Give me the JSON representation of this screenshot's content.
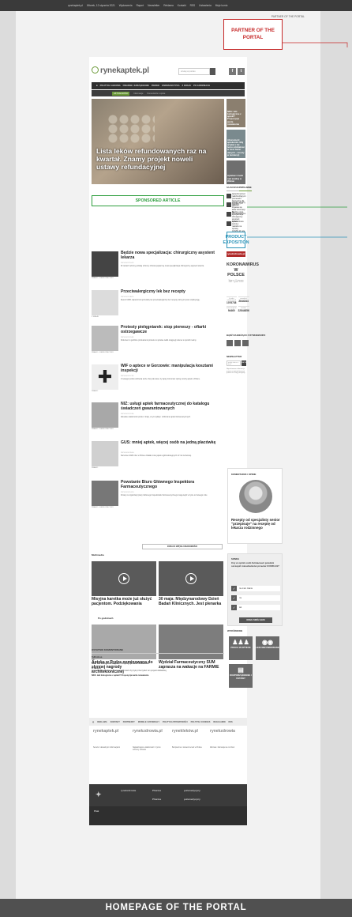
{
  "topbar": {
    "items": [
      "rynekaptek.pl",
      "Wtorek, 12 stycznia 2021",
      "Wydarzenia",
      "Raport",
      "Newsletter",
      "Reklama",
      "Kontakt",
      "RSS",
      "Ustawienia",
      "Moje konto"
    ]
  },
  "annotations": {
    "partner_label": "PARTNER OF THE PORTAL",
    "partner_box": "PARTNER OF THE PORTAL",
    "sponsored": "SPONSORED ARTICLE",
    "product": "PRODUCT EXPOSITION",
    "homepage_caption": "HOMEPAGE OF THE PORTAL"
  },
  "header": {
    "logo": "rynekaptek.pl",
    "search_placeholder": "szukaj w portalu",
    "social": [
      "f",
      "t"
    ]
  },
  "nav": {
    "main": [
      "POLITYKA LEKOWA",
      "FINANSE I ZARZĄDZANIE",
      "PRAWO",
      "FARMACEUTYKA",
      "Z KRAJU",
      "PO GODZINACH"
    ],
    "sub": [
      "AKTUALNOŚCI",
      "Informacje",
      "Komentarze i opinie"
    ]
  },
  "hero": {
    "title": "Lista leków refundowanych raz na kwartał. Znamy projekt noweli ustawy refundacyjnej"
  },
  "side_thumbs": [
    "NRA: leki biologiczne z apteki? Propozycja warta rozważenia",
    "Abonament aptekarski. Mój artykuł z lat temu oddziałowi w sieci bazie danych – koszty w tendencji",
    "Aptekarz trudzi nad analizą w Wuhan"
  ],
  "tabs": [
    "NAJNOWSZE",
    "POPULARNE"
  ],
  "popular": [
    "Apteczki przed nadchodzącymi procesami. Narzędzia dla aptekarzy w aptece",
    "Kolejny skrajny ruch! 10. Pojawia się kilka informacji po przekształceniu",
    "Będzie nowa specjalizacja: chirurgiczny asystent lekarza",
    "Apteki: Nowe terminy nalotów na sprawy COVID-19, ale nie ma szansy"
  ],
  "exposition_widget": {
    "header": "rynekzdrowia.pl",
    "title": "KORONAWIRUS W POLSCE",
    "date": "Stan na 11 stycznia 2021 r. godz. 10:30",
    "stats": [
      {
        "value": "1076738",
        "label": "Liczba zakażonych"
      },
      {
        "value": "2844344",
        "label": "zmarłych"
      },
      {
        "value": "94460",
        "label": "zaszczepieni"
      },
      {
        "value": "22844856",
        "label": "testów"
      }
    ]
  },
  "follow_title": "BĄDŹ NA BIEŻĄCO Z RYNKIEM.INFO",
  "newsletter": {
    "title": "NEWSLETTER",
    "placeholder": "podaj adres e-mail",
    "button": "ZAPISZ",
    "desc": "Najciekawsze informacje prosto ze świata farmacji prosto na Twoją skrzynkę"
  },
  "articles": [
    {
      "title": "Będzie nowa specjalizacja: chirurgiczny asystent lekarza",
      "category": "PRAWO I ORZECZNICTWO",
      "date": "2021-01-12 10:25",
      "excerpt": "W ramach reformy polskiej ochrony zdrowia pojawi się nowa specjalizacja chirurgiczny asystent lekarza."
    },
    {
      "title": "Przeciwalergiczny lek bez recepty",
      "category": "Z KRAJU",
      "date": "2021-01-12 08:15",
      "excerpt": "Resort URPL dopuścił do sprzedaży lek przeciwalergiczny bez recepty, który przynosi szybką ulgę."
    },
    {
      "title": "Protesty pielęgniarek: stop pierwszy - ofiarki ostrzegawcze",
      "category": "PRAWO I ORZECZNICTWO",
      "date": "2021-01-11 19:05",
      "excerpt": "Dokument o godzinie przekazaniu protestu w sprawie walki osiągnęły sukces w sposób realny."
    },
    {
      "title": "WIF o aptece w Gorzowie: manipulacja kosztami inspekcji",
      "category": "PRAWO",
      "date": "2021-01-11 17:30",
      "excerpt": "Z nowego punktu widzenia tenże chcę tak wiele, by lepiej zrozumieć opinię; koszty aptek w Polsce."
    },
    {
      "title": "NIZ: usługi aptek farmaceutycznej do katalogu świadczeń gwarantowanych",
      "category": "PRAWO I ORZECZNICTWO",
      "date": "2021-01-11 12:40",
      "excerpt": "Aktualne wiadomości prosto z kraju, w tym opłaty i rozliczanie aptek farmaceutycznych."
    },
    {
      "title": "GUS: mniej aptek, więcej osób na jedną placówkę",
      "category": "PRAWO",
      "date": "2021-01-10 20:00",
      "excerpt": "Na koniec 2020 roku w Polsce działało mniej aptek ogólnodostępnych niż rok wcześniej."
    },
    {
      "title": "Powstanie Biuro Głównego Inspektora Farmaceutycznego",
      "category": "PRAWO I ORZECZNICTWO",
      "date": "2021-01-10 14:10",
      "excerpt": "Zmiany w organizacji pracy Głównego Inspektoratu Farmaceutycznego mają wejść w życie od nowego roku."
    }
  ],
  "more_button": "ZOBACZ WIĘCEJ WIADOMOŚCI",
  "multimedia": {
    "title": "Multimedia",
    "items": [
      {
        "title": "Misyjna karetka może już służyć pacjentom. Podziękowania"
      },
      {
        "title": "30 maja: Międzynarodowy Dzień Badań Klinicznych. Jest plenarka"
      }
    ]
  },
  "after_hours": {
    "title": "Po godzinach",
    "items": [
      {
        "title": "Apteka w Rydze nominowana do słynnej nagrody architektonicznej"
      },
      {
        "title": "Wydział Farmaceutyczny SUM zaprasza na wakacje na FARMIE"
      }
    ]
  },
  "comment_widget": {
    "header": "KOMENTARZE I OPINIE",
    "title": "Recepty od specjalisty senior \"przepisuje\" na receptę od lekarza rodzinnego"
  },
  "poll": {
    "header": "SONDA",
    "question": "Czy w opinii osób farmaceuci powinni szczepić mieszkańców przeciw COVID-19?",
    "options": [
      "nie mam zdania",
      "nie",
      "tak"
    ],
    "button": "ODDAJ SWÓJ GŁOS"
  },
  "featured": {
    "title": "WYRÓŻNIONE",
    "tiles": [
      "PRACA W APTECE",
      "LEKI REFUNDOWANE",
      "ROZPORZĄDZENIA I USTAWY"
    ]
  },
  "comments": {
    "title": "OSTATNIO KOMENTOWANE",
    "items": [
      {
        "author": "Taltholissa",
        "text": "Tak.",
        "link": "NRA: leki biologiczne z apteki? Propozycja warta rozważenia"
      },
      {
        "author": "S. Kirszot",
        "text": "Zastanawiam się nad sytuacją aptek i warto by było przemyśleć ten projekt dokładniej.",
        "link": "NRA: leki biologiczne z apteki? Propozycja warta rozważenia"
      }
    ]
  },
  "footer": {
    "nav": [
      "REKLAMA",
      "KONTAKT",
      "PARTNERZY",
      "MODELE I MATERIAŁY",
      "POLITYKA PRYWATNOŚCI",
      "POLITYKA COOKIES",
      "REGULAMIN",
      "RSS"
    ],
    "logos": [
      "rynekaptek.pl",
      "rynekzdrowia.pl",
      "rynekleków.pl",
      "rynekzdrowia"
    ],
    "col_texts": [
      "Serwis z aktualnymi informacjami",
      "Najważniejsze wiadomości z rynku ochrony zdrowia",
      "Bezpieczne i skuteczne leki w Polsce",
      "Zdrowie i farmacja na co dzień"
    ],
    "dark_label": "Ptak",
    "dark_logos": [
      "rynekzdrowia",
      "Pharma",
      "pulsmedycyny",
      "Pharma",
      "pulsmedycyny"
    ]
  }
}
